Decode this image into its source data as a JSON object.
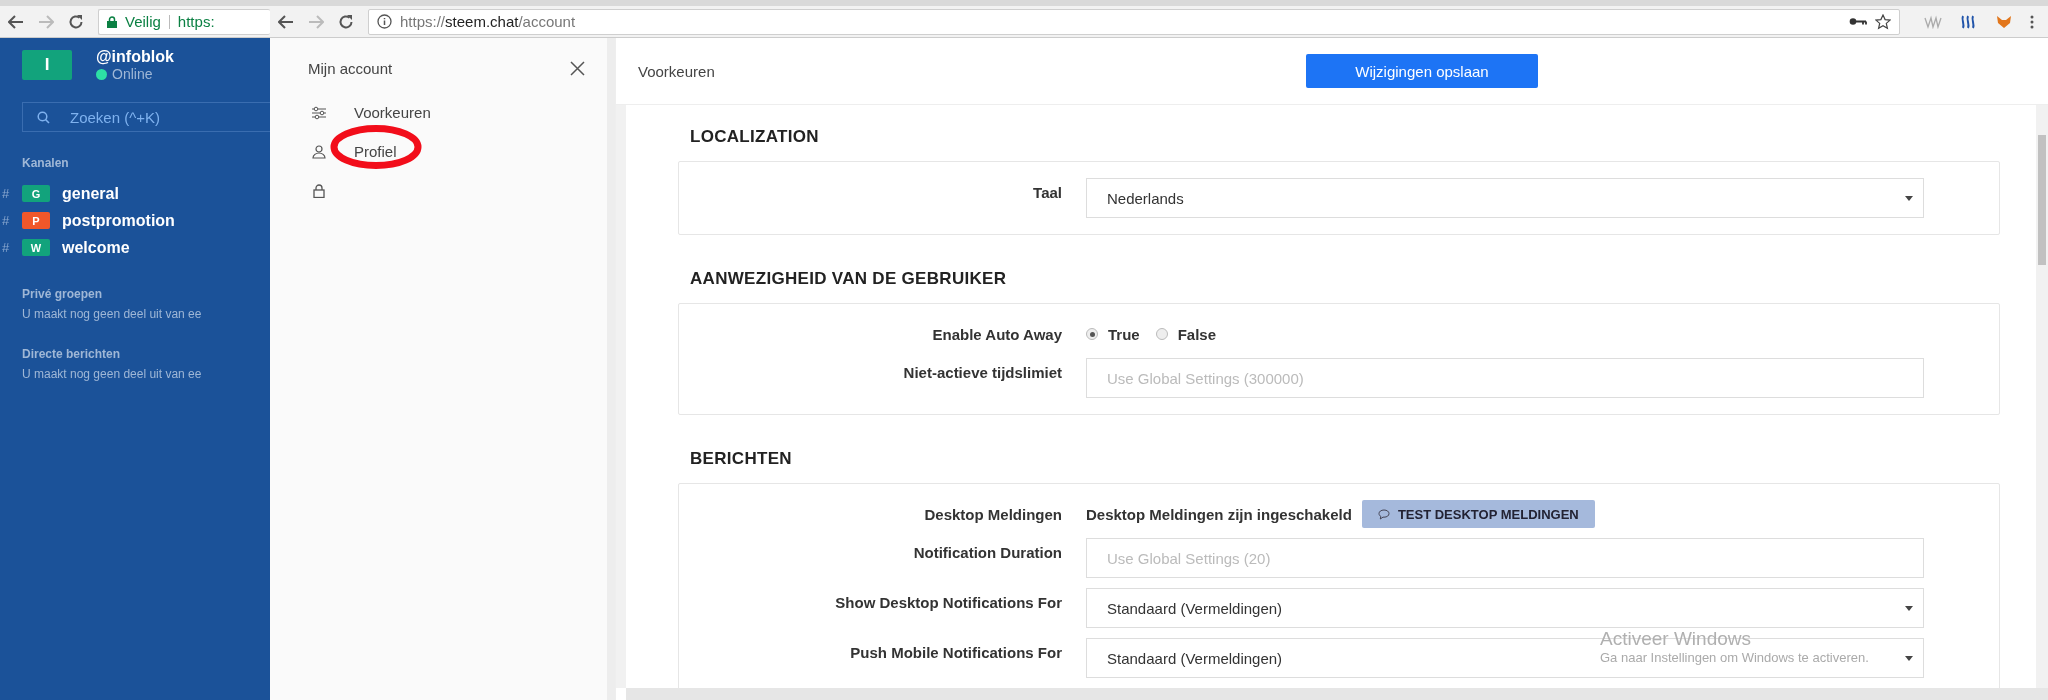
{
  "left_window": {
    "address_bar": {
      "security": "Veilig",
      "url": "https:"
    },
    "sidebar": {
      "avatar": "I",
      "username": "@infoblok",
      "status": "Online",
      "search": {
        "placeholder": "Zoeken (^+K)"
      },
      "channels_heading": "Kanalen",
      "channels": [
        {
          "symbol": "#",
          "badge": "G",
          "name": "general",
          "color": "#12a37c"
        },
        {
          "symbol": "#",
          "badge": "P",
          "name": "postpromotion",
          "color": "#f0572a"
        },
        {
          "symbol": "#",
          "badge": "W",
          "name": "welcome",
          "color": "#12a37c"
        }
      ],
      "sections": [
        {
          "title": "Privé groepen",
          "text": "U maakt nog geen deel uit van ee"
        },
        {
          "title": "Directe berichten",
          "text": "U maakt nog geen deel uit van ee"
        }
      ]
    }
  },
  "right_window": {
    "address_bar": {
      "scheme": "https://",
      "host": "steem.chat",
      "path": "/account"
    },
    "account_panel": {
      "title": "Mijn account",
      "items": [
        {
          "kind": "preferences",
          "label": "Voorkeuren"
        },
        {
          "kind": "profile",
          "label": "Profiel"
        },
        {
          "kind": "security"
        }
      ]
    },
    "header": {
      "title": "Voorkeuren",
      "save_button": "Wijzigingen opslaan"
    },
    "sections": [
      {
        "title": "LOCALIZATION",
        "rows": [
          {
            "kind": "select",
            "label": "Taal",
            "value": "Nederlands"
          }
        ]
      },
      {
        "title": "AANWEZIGHEID VAN DE GEBRUIKER",
        "rows": [
          {
            "kind": "radio",
            "label": "Enable Auto Away",
            "options": [
              {
                "label": "True",
                "selected": true
              },
              {
                "label": "False",
                "selected": false
              }
            ]
          },
          {
            "kind": "input",
            "label": "Niet-actieve tijdslimiet",
            "placeholder": "Use Global Settings (300000)"
          }
        ]
      },
      {
        "title": "BERICHTEN",
        "rows": [
          {
            "kind": "status",
            "label": "Desktop Meldingen",
            "text": "Desktop Meldingen zijn ingeschakeld",
            "button": "TEST DESKTOP MELDINGEN"
          },
          {
            "kind": "input",
            "label": "Notification Duration",
            "placeholder": "Use Global Settings (20)"
          },
          {
            "kind": "select",
            "label": "Show Desktop Notifications For",
            "value": "Standaard (Vermeldingen)"
          },
          {
            "kind": "select",
            "label": "Push Mobile Notifications For",
            "value": "Standaard (Vermeldingen)"
          }
        ]
      }
    ],
    "activation_notice": {
      "title": "Activeer Windows",
      "text": "Ga naar Instellingen om Windows te activeren."
    }
  }
}
